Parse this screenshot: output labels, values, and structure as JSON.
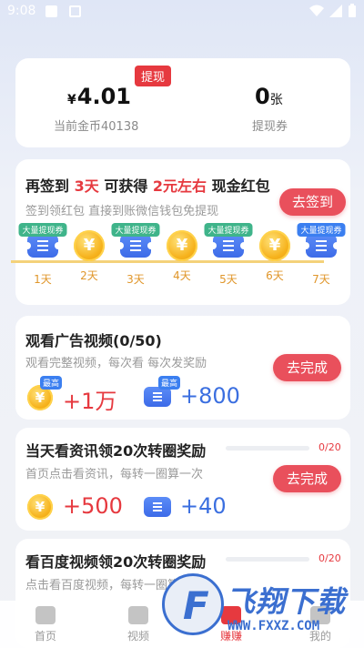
{
  "status_bar": {
    "time": "9:08"
  },
  "wallet": {
    "withdraw_badge": "提现",
    "currency_symbol": "¥",
    "amount": "4.01",
    "coins_label": "当前金币40138",
    "tickets_count": "0",
    "tickets_unit": "张",
    "tickets_label": "提现券"
  },
  "checkin": {
    "title_part1": "再签到",
    "title_days": "3天",
    "title_part2": "可获得",
    "title_amount": "2元左右",
    "title_part3": "现金红包",
    "description": "签到领红包 直接到账微信钱包免提现",
    "button": "去签到",
    "days": [
      {
        "label": "1天",
        "type": "ticket",
        "tag": "大量提现券"
      },
      {
        "label": "2天",
        "type": "coin",
        "tag": ""
      },
      {
        "label": "3天",
        "type": "ticket",
        "tag": "大量提现券"
      },
      {
        "label": "4天",
        "type": "coin",
        "tag": ""
      },
      {
        "label": "5天",
        "type": "ticket",
        "tag": "大量提现券"
      },
      {
        "label": "6天",
        "type": "coin",
        "tag": ""
      },
      {
        "label": "7天",
        "type": "ticket",
        "tag": "大量提现券"
      }
    ],
    "coin_glyph": "¥"
  },
  "tasks": [
    {
      "title": "观看广告视频(0/50)",
      "description": "观看完整视频，每次看 每次发奖励",
      "button": "去完成",
      "coin_reward": "+1万",
      "ticket_reward": "+800",
      "best_tag": "最高"
    },
    {
      "title": "当天看资讯领20次转圈奖励",
      "description": "首页点击看资讯，每转一圈算一次",
      "button": "去完成",
      "progress_text": "0/20",
      "progress": 0,
      "coin_reward": "+500",
      "ticket_reward": "+40"
    },
    {
      "title": "看百度视频领20次转圈奖励",
      "description": "点击看百度视频，每转一圈算一次",
      "progress_text": "0/20",
      "progress": 0
    }
  ],
  "bottom_nav": [
    {
      "label": "首页"
    },
    {
      "label": "视频"
    },
    {
      "label": "赚赚"
    },
    {
      "label": "我的"
    }
  ],
  "watermark": {
    "text": "飞翔下载",
    "url": "WWW.FXXZ.COM"
  },
  "colors": {
    "accent": "#e6393f",
    "button": "#e9505c",
    "ticket_blue": "#3d6be8",
    "coin_gold": "#f6b21c"
  }
}
